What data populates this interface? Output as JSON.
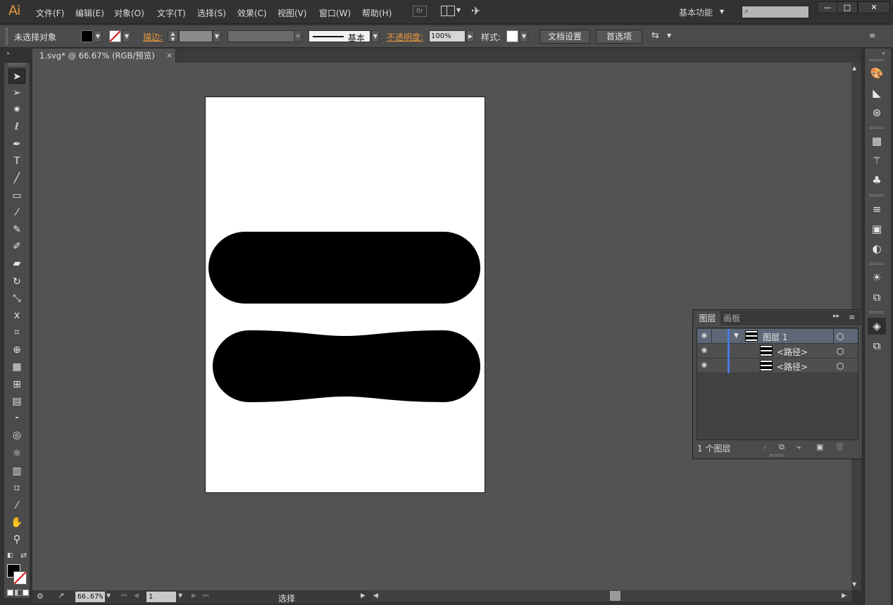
{
  "app": {
    "logo": "Ai"
  },
  "menu": [
    "文件(F)",
    "编辑(E)",
    "对象(O)",
    "文字(T)",
    "选择(S)",
    "效果(C)",
    "视图(V)",
    "窗口(W)",
    "帮助(H)"
  ],
  "topbar": {
    "bridge": "Br",
    "workspace": "基本功能",
    "search_placeholder": "",
    "minimize": "—",
    "restore": "□",
    "close": "✕"
  },
  "control": {
    "selection_status": "未选择对象",
    "stroke_label": "描边:",
    "stroke_profile": "基本",
    "opacity_label": "不透明度:",
    "opacity_value": "100%",
    "style_label": "样式:",
    "doc_setup": "文档设置",
    "preferences": "首选项"
  },
  "document": {
    "tab_title": "1.svg* @ 66.67% (RGB/预览)",
    "tab_close": "×"
  },
  "status": {
    "zoom": "66.67%",
    "page": "1",
    "text": "选择"
  },
  "layers_panel": {
    "tabs": [
      "图层",
      "画板"
    ],
    "rows": [
      {
        "name": "图层 1",
        "selected": true,
        "expanded": true
      },
      {
        "name": "<路径>",
        "selected": false
      },
      {
        "name": "<路径>",
        "selected": false
      }
    ],
    "footer": "1 个图层"
  },
  "colors": {
    "accent": "#e8993e",
    "layer_color": "#4a78e0",
    "canvas": "#535353",
    "artboard": "#ffffff"
  },
  "toolbox_icons": [
    "selection-tool-icon",
    "direct-selection-tool-icon",
    "magic-wand-icon",
    "lasso-icon",
    "pen-icon",
    "type-icon",
    "line-icon",
    "rectangle-icon",
    "paintbrush-icon",
    "pencil-icon",
    "blob-brush-icon",
    "eraser-icon",
    "rotate-icon",
    "scale-icon",
    "warp-icon",
    "free-transform-icon",
    "shape-builder-icon",
    "graph-icon",
    "mesh-icon",
    "gradient-icon",
    "eyedropper-icon",
    "blend-icon",
    "symbol-sprayer-icon",
    "column-graph-icon",
    "artboard-icon",
    "slice-icon",
    "hand-icon",
    "zoom-icon"
  ]
}
